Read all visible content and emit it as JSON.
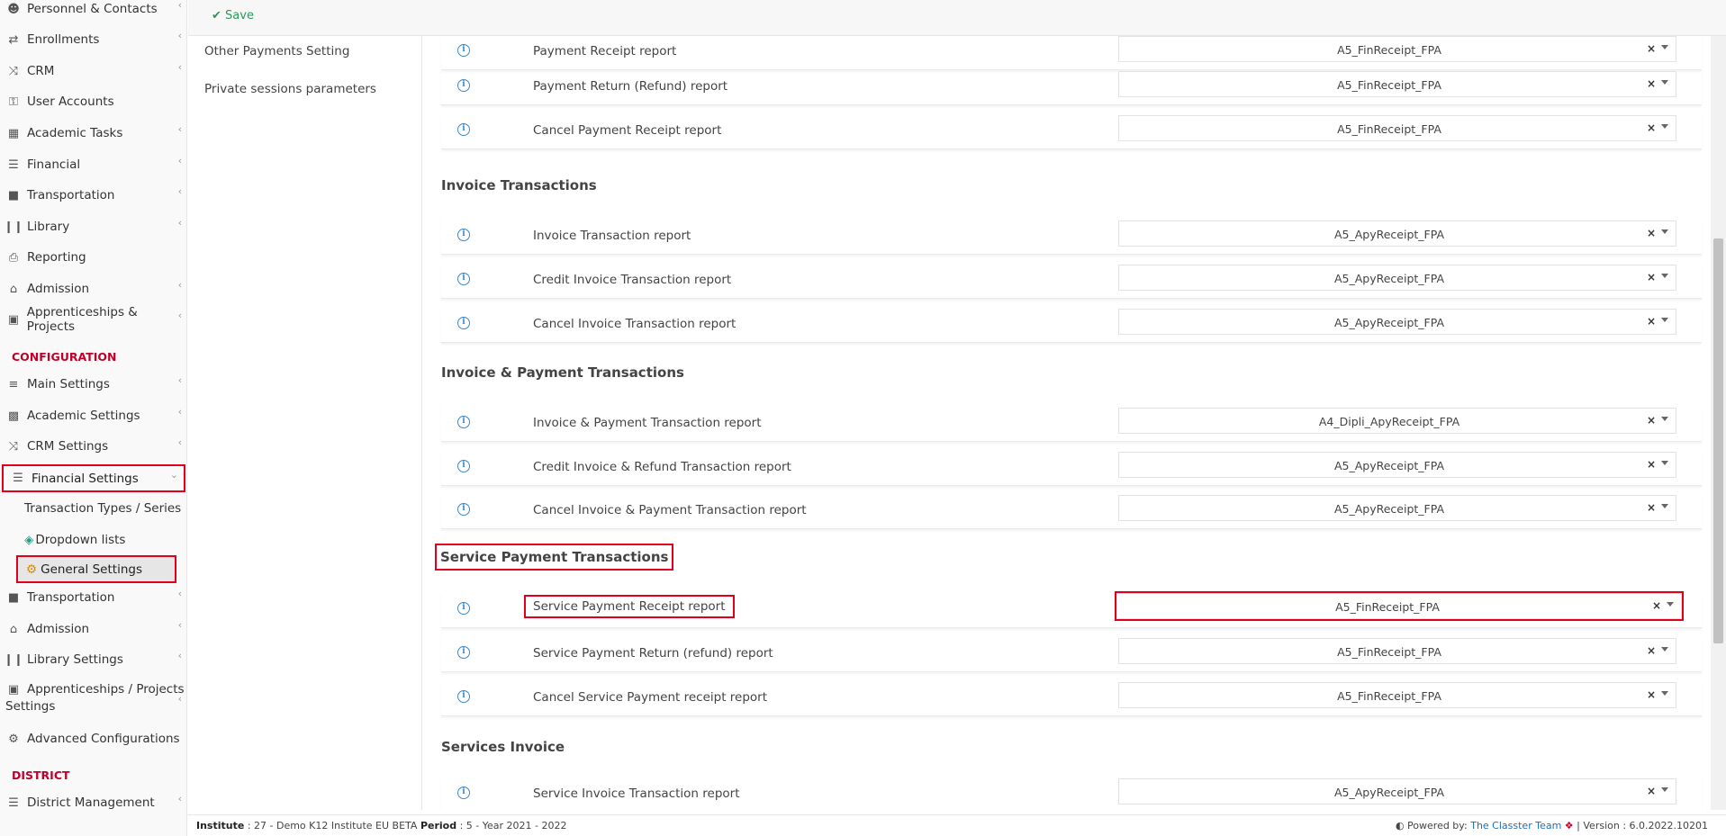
{
  "sidebar": {
    "items": [
      {
        "label": "Personnel & Contacts",
        "icon": "people-icon"
      },
      {
        "label": "Enrollments",
        "icon": "arrows-icon"
      },
      {
        "label": "CRM",
        "icon": "shuffle-icon"
      },
      {
        "label": "User Accounts",
        "icon": "key-icon"
      },
      {
        "label": "Academic Tasks",
        "icon": "grid-icon"
      },
      {
        "label": "Financial",
        "icon": "coins-icon"
      },
      {
        "label": "Transportation",
        "icon": "bus-icon"
      },
      {
        "label": "Library",
        "icon": "books-icon"
      },
      {
        "label": "Reporting",
        "icon": "printer-icon"
      },
      {
        "label": "Admission",
        "icon": "institution-icon"
      },
      {
        "label": "Apprenticeships & Projects",
        "icon": "cube-icon"
      }
    ],
    "config_section": "CONFIGURATION",
    "config_items": [
      {
        "label": "Main Settings",
        "icon": "sliders-icon"
      },
      {
        "label": "Academic Settings",
        "icon": "org-icon"
      },
      {
        "label": "CRM Settings",
        "icon": "shuffle-icon"
      },
      {
        "label": "Financial Settings",
        "icon": "coins-icon"
      }
    ],
    "financial_sub": [
      {
        "label": "Transaction Types / Series",
        "icon": ""
      },
      {
        "label": "Dropdown lists",
        "icon": "layers-icon"
      },
      {
        "label": "General Settings",
        "icon": "gear-icon"
      }
    ],
    "config_items_2": [
      {
        "label": "Transportation",
        "icon": "bus-icon"
      },
      {
        "label": "Admission",
        "icon": "institution-icon"
      },
      {
        "label": "Library Settings",
        "icon": "books-icon"
      },
      {
        "label": "Apprenticeships / Projects",
        "label2": "Settings",
        "icon": "cube-icon"
      },
      {
        "label": "Advanced Configurations",
        "icon": "gears-icon"
      }
    ],
    "district_section": "DISTRICT",
    "district_items": [
      {
        "label": "District Management",
        "icon": "menu-icon"
      }
    ]
  },
  "submenu": {
    "items": [
      "Other Payments Setting",
      "Private sessions parameters"
    ]
  },
  "toolbar": {
    "save_label": "Save"
  },
  "groups": [
    {
      "title": "",
      "rows": [
        {
          "label": "Payment Receipt report",
          "value": "A5_FinReceipt_FPA"
        },
        {
          "label": "Payment Return (Refund) report",
          "value": "A5_FinReceipt_FPA"
        },
        {
          "label": "Cancel Payment Receipt report",
          "value": "A5_FinReceipt_FPA"
        }
      ]
    },
    {
      "title": "Invoice Transactions",
      "rows": [
        {
          "label": "Invoice Transaction report",
          "value": "A5_ApyReceipt_FPA"
        },
        {
          "label": "Credit Invoice Transaction report",
          "value": "A5_ApyReceipt_FPA"
        },
        {
          "label": "Cancel Invoice Transaction report",
          "value": "A5_ApyReceipt_FPA"
        }
      ]
    },
    {
      "title": "Invoice & Payment Transactions",
      "rows": [
        {
          "label": "Invoice & Payment Transaction report",
          "value": "A4_Dipli_ApyReceipt_FPA"
        },
        {
          "label": "Credit Invoice & Refund Transaction report",
          "value": "A5_ApyReceipt_FPA"
        },
        {
          "label": "Cancel Invoice & Payment Transaction report",
          "value": "A5_ApyReceipt_FPA"
        }
      ]
    },
    {
      "title": "Service Payment Transactions",
      "rows": [
        {
          "label": "Service Payment Receipt report",
          "value": "A5_FinReceipt_FPA"
        },
        {
          "label": "Service Payment Return (refund) report",
          "value": "A5_FinReceipt_FPA"
        },
        {
          "label": "Cancel Service Payment receipt report",
          "value": "A5_FinReceipt_FPA"
        }
      ]
    },
    {
      "title": "Services Invoice",
      "rows": [
        {
          "label": "Service Invoice Transaction report",
          "value": "A5_ApyReceipt_FPA"
        }
      ]
    }
  ],
  "footer": {
    "institute_label": "Institute",
    "institute_value": ": 27 - Demo K12 Institute EU BETA",
    "period_label": "Period",
    "period_value": ": 5 - Year 2021 - 2022",
    "powered_by": "Powered by:",
    "team": "The Classter Team",
    "version": "| Version : 6.0.2022.10201"
  },
  "colors": {
    "accent_red": "#c0002a",
    "highlight": "#e0001b",
    "save_green": "#2a9a5a",
    "info_blue": "#3a87c8"
  }
}
